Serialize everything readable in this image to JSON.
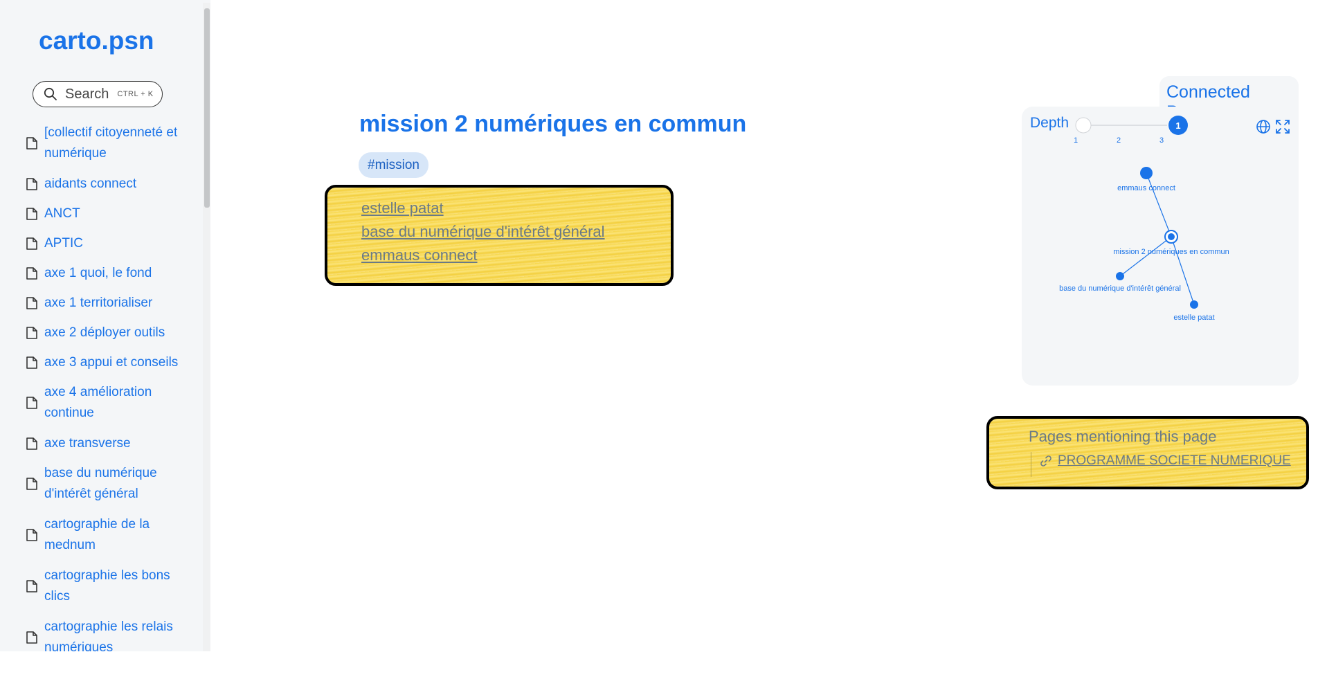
{
  "site": {
    "brand": "carto.psn"
  },
  "search": {
    "label": "Search",
    "shortcut": "CTRL + K"
  },
  "sidebar": {
    "items": [
      {
        "label": "[collectif citoyenneté et numérique"
      },
      {
        "label": "aidants connect"
      },
      {
        "label": "ANCT"
      },
      {
        "label": "APTIC"
      },
      {
        "label": "axe 1 quoi, le fond"
      },
      {
        "label": "axe 1 territorialiser"
      },
      {
        "label": "axe 2 déployer outils"
      },
      {
        "label": "axe 3 appui et conseils"
      },
      {
        "label": "axe 4 amélioration continue"
      },
      {
        "label": "axe transverse"
      },
      {
        "label": "base du numérique d'intérêt général"
      },
      {
        "label": "cartographie de la mednum"
      },
      {
        "label": "cartographie les bons clics"
      },
      {
        "label": "cartographie les relais numériques"
      }
    ]
  },
  "page": {
    "title": "mission 2 numériques en commun",
    "tag": "#mission",
    "links": [
      "estelle patat",
      "base du numérique d'intérêt général",
      "emmaus connect"
    ]
  },
  "connected": {
    "tab_label": "Connected Pages",
    "depth_label": "Depth",
    "depth_ticks": [
      "1",
      "2",
      "3"
    ],
    "depth_value": "1",
    "graph_nodes": [
      {
        "label": "emmaus connect"
      },
      {
        "label": "mission 2 numériques en commun"
      },
      {
        "label": "base du numérique d'intérêt général"
      },
      {
        "label": "estelle patat"
      }
    ]
  },
  "mentions": {
    "title": "Pages mentioning this page",
    "links": [
      "PROGRAMME SOCIETE NUMERIQUE"
    ]
  },
  "colors": {
    "accent": "#1a73e8",
    "highlight": "#f7d64a",
    "panel_bg": "#f4f6f8"
  }
}
